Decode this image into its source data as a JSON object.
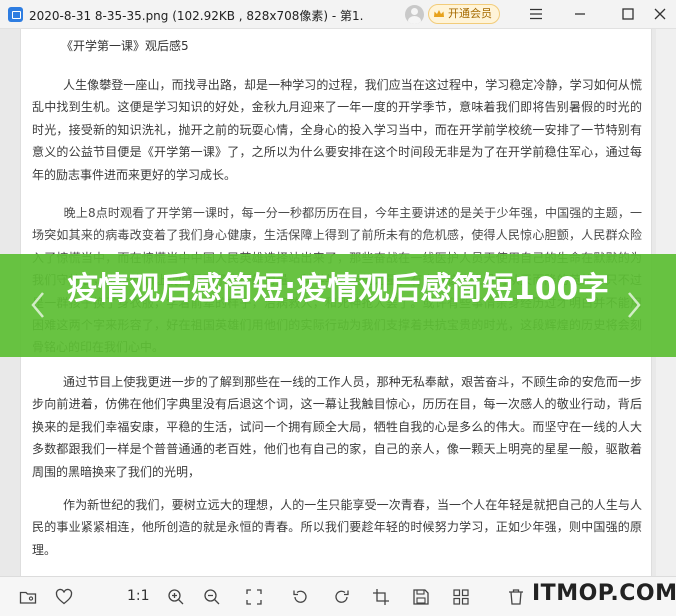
{
  "window": {
    "title": "2020-8-31 8-35-35.png (102.92KB , 828x708像素) - 第1...",
    "vip_label": "开通会员"
  },
  "document": {
    "title": "《开学第一课》观后感5",
    "paragraphs": [
      "        人生像攀登一座山，而找寻出路，却是一种学习的过程，我们应当在这过程中，学习稳定冷静，学习如何从慌乱中找到生机。这便是学习知识的好处，金秋九月迎来了一年一度的开学季节，意味着我们即将告别暑假的时光的时光，接受新的知识洗礼，抛开之前的玩耍心情，全身心的投入学习当中，而在开学前学校统一安排了一节特别有意义的公益节目便是《开学第一课》了，之所以为什么要安排在这个时间段无非是为了在开学前稳住军心，通过每年的励志事件进而来更好的学习成长。",
      "        晚上8点时观看了开学第一课时，每一分一秒都历历在目，今年主要讲述的是关于少年强，中国强的主题，一场突如其来的病毒改变着了我们身心健康，生活保障上得到了前所未有的危机感，使得人民惊心胆颤，人民群众险入了惊慌当中，而在惊慌当中中国人民英雄选择站出来了，那些奋战在一线医护人员天使用自己的生命在默默的为我们守护着，也是他们让我们看到了中国的力量，科学与人类的力量，有人说这世上没有从天而降的英雄，只不过是一群孩子换了身衣服，学着前辈的样子，治病救人，和死神抢人罢了。或许有些事情亲身经历过才明白并不能用困难这两个字来形容了，好在祖国英雄们用他们的实际行动为我们支撑着共抗宝贵的时光，这段辉煌的历史将会刻骨铭心的印在我们心中。",
      "        通过节目上使我更进一步的了解到那些在一线的工作人员，那种无私奉献，艰苦奋斗，不顾生命的安危而一步步向前进着，仿佛在他们字典里没有后退这个词，这一幕让我触目惊心，历历在目，每一次感人的敬业行动，背后换来的是我们幸福安康，平稳的生活，试问一个拥有顾全大局，牺牲自我的心是多么的伟大。而坚守在一线的人大多数都跟我们一样是个普普通通的老百姓，他们也有自己的家，自己的亲人，像一颗天上明亮的星星一般，驱散着周围的黑暗换来了我们的光明，",
      "        作为新世纪的我们，要树立远大的理想，人的一生只能享受一次青春，当一个人在年轻是就把自己的人生与人民的事业紧紧相连，他所创造的就是永恒的青春。所以我们要趁年轻的时候努力学习，正如少年强，则中国强的原理。"
    ]
  },
  "banner": {
    "headline": "疫情观后感简短:疫情观后感简短100字"
  },
  "toolbar": {
    "ratio_label": "1:1",
    "watermark": "ITMOP.COM"
  },
  "icons": {
    "minimize": "minimize-icon",
    "maximize": "maximize-icon",
    "close": "close-icon",
    "menu": "menu-icon"
  }
}
